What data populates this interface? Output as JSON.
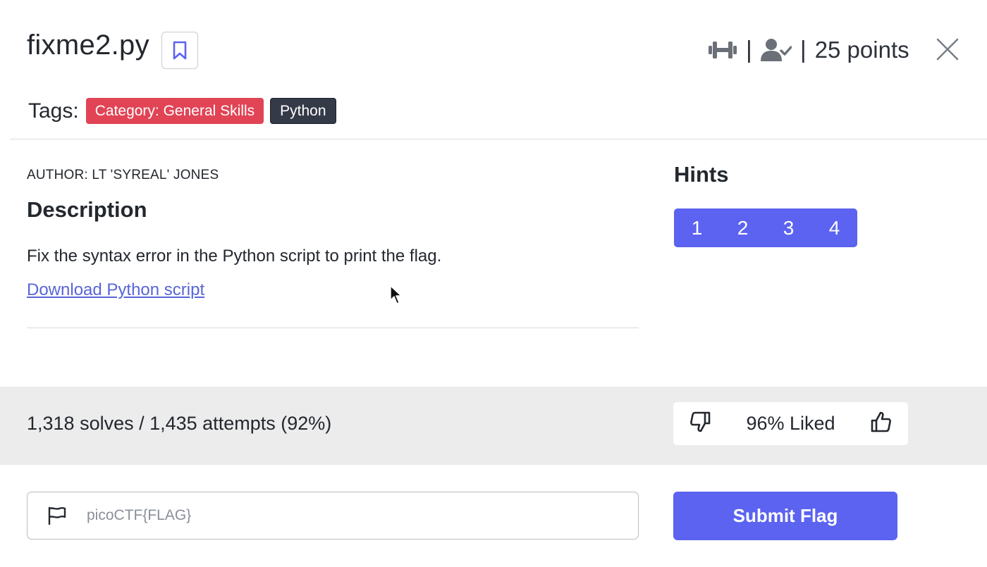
{
  "challenge": {
    "title": "fixme2.py",
    "points": "25 points",
    "meta_separator": "|"
  },
  "tags": {
    "label": "Tags:",
    "items": [
      "Category: General Skills",
      "Python"
    ]
  },
  "content": {
    "author": "AUTHOR: LT 'SYREAL' JONES",
    "description_heading": "Description",
    "description_text": "Fix the syntax error in the Python script to print the flag.",
    "download_link": "Download Python script"
  },
  "hints": {
    "heading": "Hints",
    "buttons": [
      "1",
      "2",
      "3",
      "4"
    ]
  },
  "stats": {
    "solves_text": "1,318 solves / 1,435 attempts (92%)",
    "liked_text": "96% Liked"
  },
  "flag_form": {
    "placeholder": "picoCTF{FLAG}",
    "submit_label": "Submit Flag"
  },
  "icons": {
    "bookmark": "bookmark-icon",
    "difficulty": "dumbbell-icon",
    "solved": "user-check-icon",
    "close": "close-icon",
    "dislike": "thumbs-down-icon",
    "like": "thumbs-up-icon",
    "flag": "flag-icon"
  },
  "colors": {
    "accent": "#5b63f0",
    "tag_category": "#e04455",
    "tag_language": "#353a48",
    "link": "#5865d8",
    "stats_bg": "#ececec"
  }
}
